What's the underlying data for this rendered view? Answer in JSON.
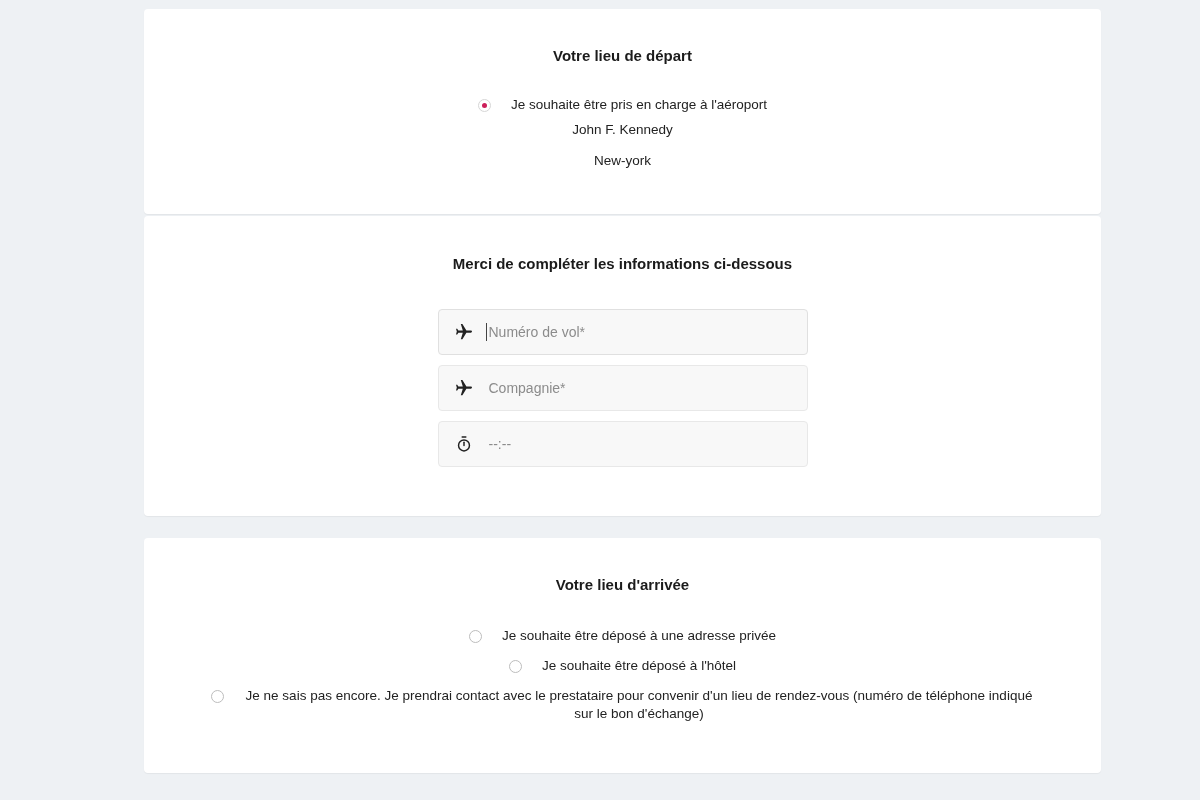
{
  "departure": {
    "title": "Votre lieu de départ",
    "options": [
      {
        "label": "Je souhaite être pris en charge à l'aéroport",
        "selected": true
      }
    ],
    "airport": "John F. Kennedy",
    "city": "New-york"
  },
  "flight_info": {
    "title": "Merci de compléter les informations ci-dessous",
    "fields": [
      {
        "kind": "plane",
        "placeholder": "Numéro de vol*",
        "focused": true
      },
      {
        "kind": "plane",
        "placeholder": "Compagnie*",
        "focused": false
      },
      {
        "kind": "time",
        "placeholder": "--:--",
        "focused": false
      }
    ]
  },
  "arrival": {
    "title": "Votre lieu d'arrivée",
    "options": [
      {
        "label": "Je souhaite être déposé à une adresse privée",
        "selected": false
      },
      {
        "label": "Je souhaite être déposé à l'hôtel",
        "selected": false
      },
      {
        "label": "Je ne sais pas encore. Je prendrai contact avec le prestataire pour convenir d'un lieu de rendez-vous (numéro de téléphone indiqué sur le bon d'échange)",
        "selected": false
      }
    ]
  }
}
